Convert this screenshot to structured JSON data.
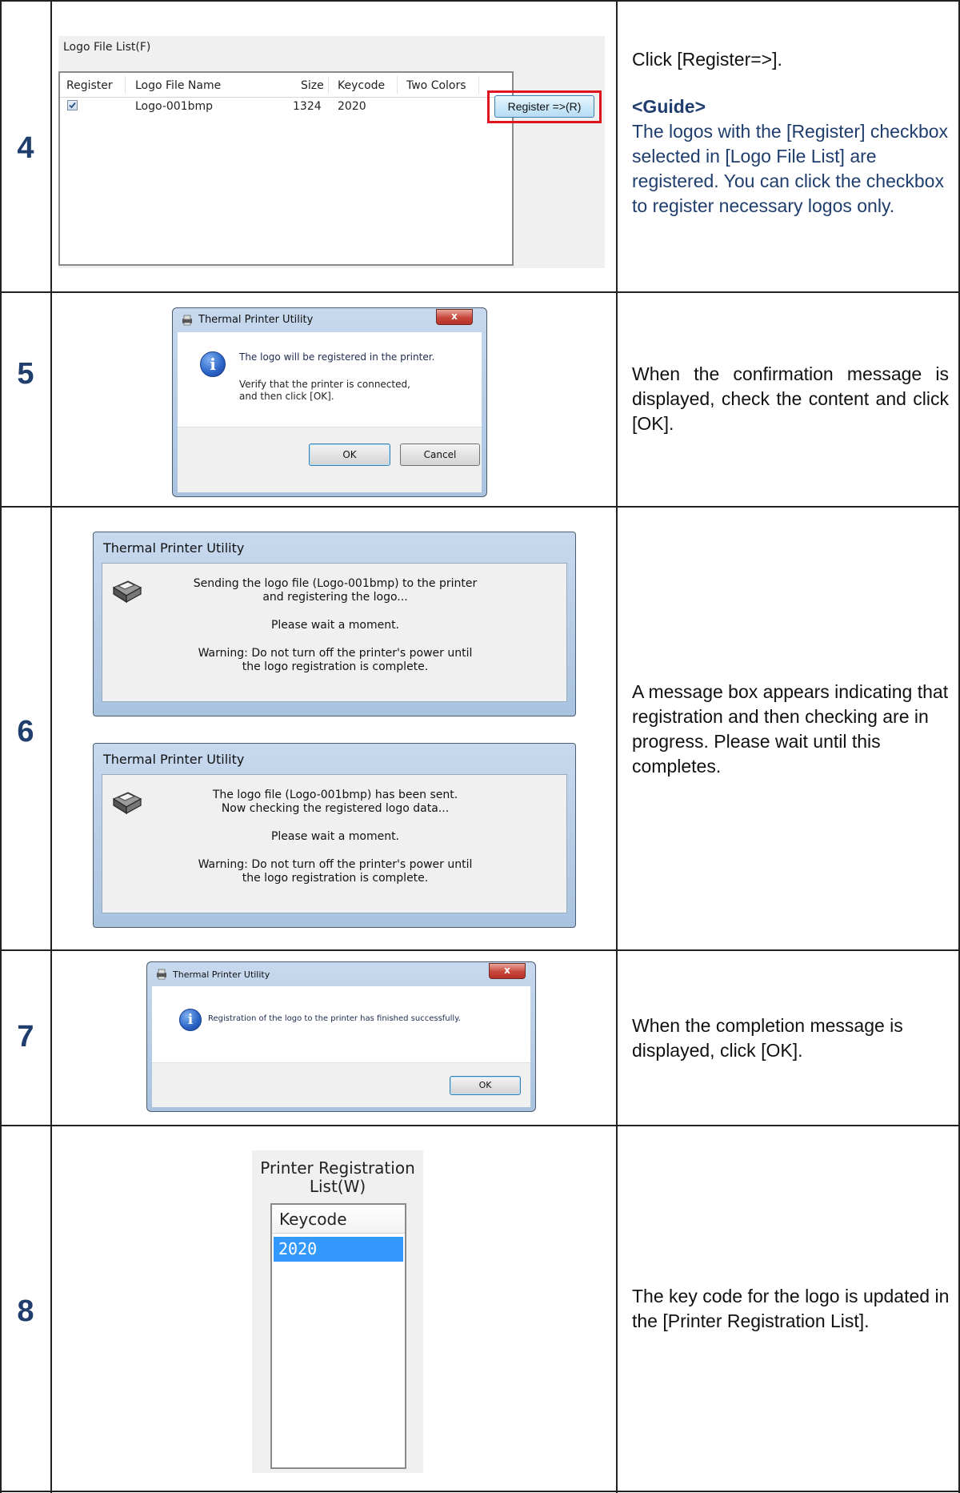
{
  "steps": [
    {
      "number": "4",
      "logo_list": {
        "title": "Logo File List(F)",
        "columns": [
          "Register",
          "Logo File Name",
          "Size",
          "Keycode",
          "Two Colors"
        ],
        "rows": [
          {
            "register": true,
            "name": "Logo-001bmp",
            "size": "1324",
            "keycode": "2020",
            "two_colors": ""
          }
        ],
        "register_button": "Register =>(R)"
      },
      "desc": {
        "intro": "Click [Register=>].",
        "guide_title": "<Guide>",
        "guide_text": "The logos with the [Register] checkbox selected in [Logo File List] are registered. You can click the checkbox to register necessary logos only."
      }
    },
    {
      "number": "5",
      "dialog": {
        "title": "Thermal Printer Utility",
        "close": "x",
        "line1": "The logo will be registered in the printer.",
        "line2": "Verify that the printer is connected,",
        "line3": "and then click [OK].",
        "ok": "OK",
        "cancel": "Cancel"
      },
      "desc": "When the confirmation message is displayed, check the content and click [OK]."
    },
    {
      "number": "6",
      "dialog_a": {
        "title": "Thermal Printer Utility",
        "line1": "Sending the logo file (Logo-001bmp) to the printer",
        "line2": "and registering the logo...",
        "line3": "Please wait a moment.",
        "line4": "Warning: Do not turn off the printer's power until",
        "line5": "the logo registration is complete."
      },
      "dialog_b": {
        "title": "Thermal Printer Utility",
        "line1": "The logo file (Logo-001bmp) has been sent.",
        "line2": "Now checking the registered logo data...",
        "line3": "Please wait a moment.",
        "line4": "Warning: Do not turn off the printer's power until",
        "line5": "the logo registration is complete."
      },
      "desc": "A message box appears indicating that registration and then checking are in progress. Please wait until this completes."
    },
    {
      "number": "7",
      "dialog": {
        "title": "Thermal Printer Utility",
        "close": "x",
        "message": "Registration of the logo to the printer has finished successfully.",
        "ok": "OK"
      },
      "desc": "When the completion message is displayed, click [OK]."
    },
    {
      "number": "8",
      "reg_list": {
        "title_line1": "Printer Registration",
        "title_line2": "List(W)",
        "column": "Keycode",
        "items": [
          "2020"
        ]
      },
      "desc": "The key code for the logo is updated in the [Printer Registration List]."
    }
  ],
  "icons": [
    "printer-icon",
    "info-icon",
    "close-icon",
    "checkbox-checked-icon"
  ],
  "colors": {
    "step_number": "#1f3d6d",
    "guide_text": "#1f3d6d",
    "highlight_box": "#e0141e",
    "selection": "#3399ff"
  }
}
